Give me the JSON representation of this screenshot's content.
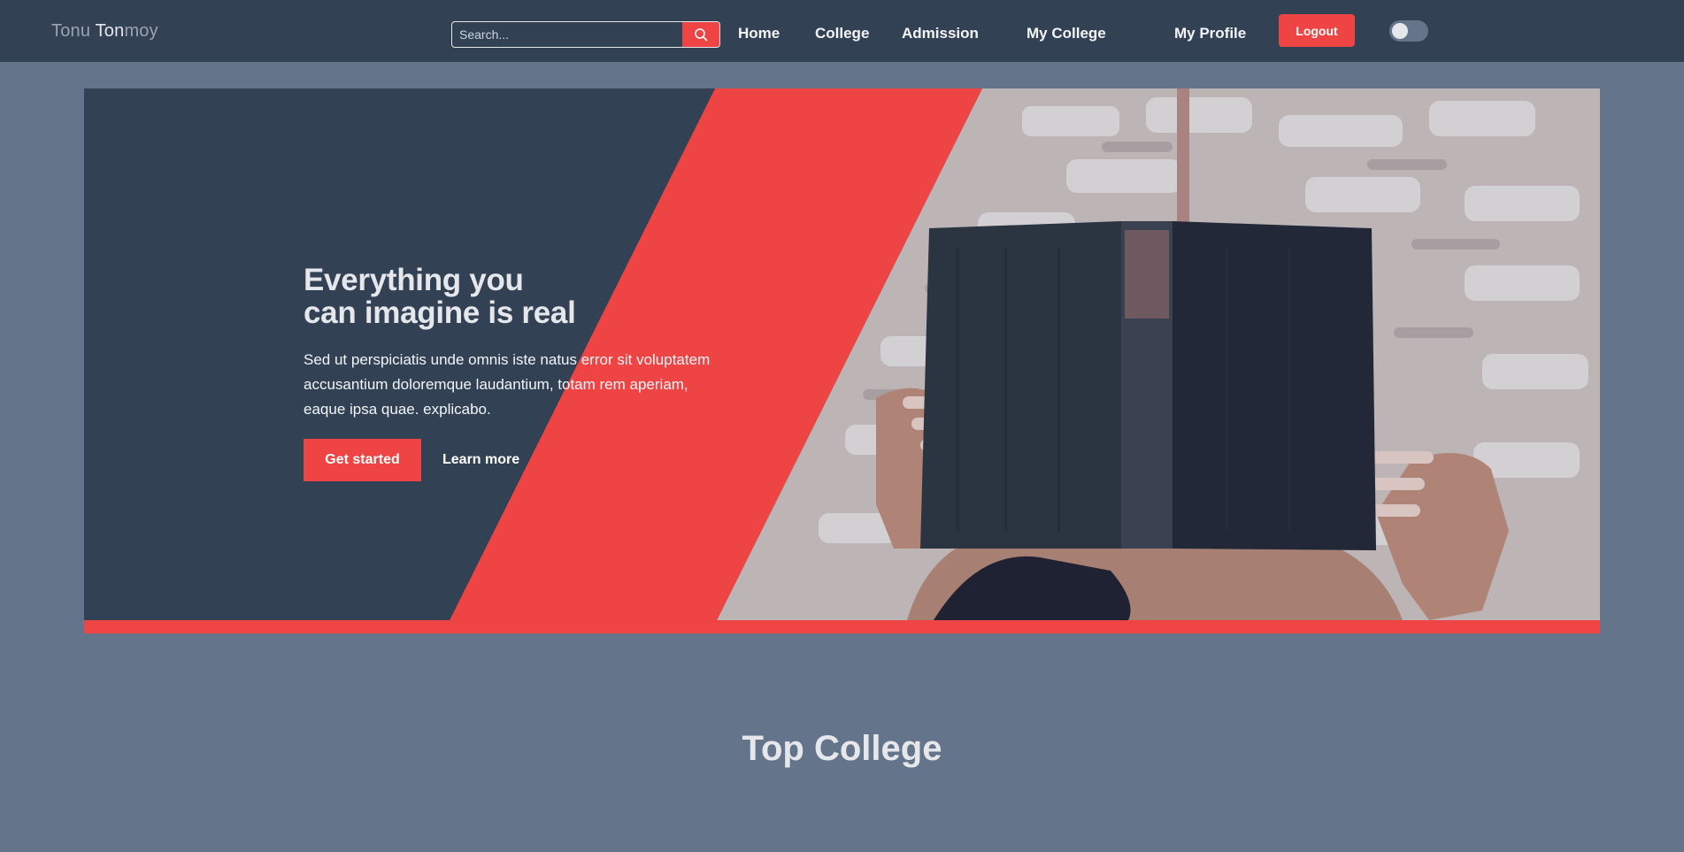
{
  "navbar": {
    "brand_first": "Tonu ",
    "brand_mid": "Ton",
    "brand_last": "moy",
    "search_placeholder": "Search...",
    "links": [
      {
        "label": "Home"
      },
      {
        "label": "College"
      },
      {
        "label": "Admission"
      },
      {
        "label": "My College"
      },
      {
        "label": "My Profile"
      }
    ],
    "logout_label": "Logout",
    "theme_toggle": "off"
  },
  "hero": {
    "title_line1": "Everything you",
    "title_line2": "can imagine is real",
    "description": "Sed ut perspiciatis unde omnis iste natus error sit voluptatem accusantium doloremque laudantium, totam rem aperiam, eaque ipsa quae. explicabo.",
    "primary_button": "Get started",
    "secondary_button": "Learn more"
  },
  "section": {
    "title": "Top College"
  },
  "colors": {
    "navbar_bg": "#334155",
    "page_bg": "#64748b",
    "accent": "#ef4444",
    "hero_dark": "#334155"
  },
  "icons": {
    "search": "search-icon",
    "hero_image": "person-reading-book-photo"
  }
}
